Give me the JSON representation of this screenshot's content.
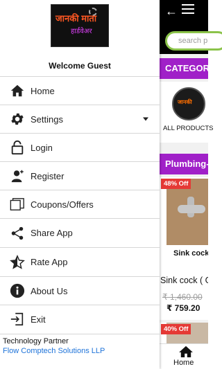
{
  "app": {
    "search_placeholder": "search p",
    "categories_label": "CATEGORIE",
    "category_card": {
      "logo_text": "जानकी",
      "label": "ALL PRODUCTS"
    },
    "section_label": "Plumbing-",
    "product": {
      "discount": "48% Off",
      "short_name": "Sink cock",
      "full_name": "Sink cock ( G",
      "price_old": "₹ 1,460.00",
      "price_new": "₹ 759.20"
    },
    "product_2": {
      "discount": "40% Off"
    },
    "bottom_nav": {
      "home_label": "Home"
    }
  },
  "drawer": {
    "logo": {
      "line1": "जानकी माता",
      "line2": "हार्डवेअर"
    },
    "welcome": "Welcome Guest",
    "items": [
      {
        "label": "Home",
        "icon": "home-icon"
      },
      {
        "label": "Settings",
        "icon": "gear-icon",
        "has_dropdown": true
      },
      {
        "label": "Login",
        "icon": "unlock-icon"
      },
      {
        "label": "Register",
        "icon": "user-add-icon"
      },
      {
        "label": "Coupons/Offers",
        "icon": "coupons-icon"
      },
      {
        "label": "Share App",
        "icon": "share-icon"
      },
      {
        "label": "Rate App",
        "icon": "star-icon"
      },
      {
        "label": "About Us",
        "icon": "info-icon"
      },
      {
        "label": "Exit",
        "icon": "exit-icon"
      }
    ],
    "partner": {
      "title": "Technology Partner",
      "name": "Flow Comptech Solutions LLP"
    }
  },
  "colors": {
    "accent": "#a020c8",
    "search_border": "#8bc34a",
    "discount": "#e53935",
    "link": "#1e73d9"
  }
}
